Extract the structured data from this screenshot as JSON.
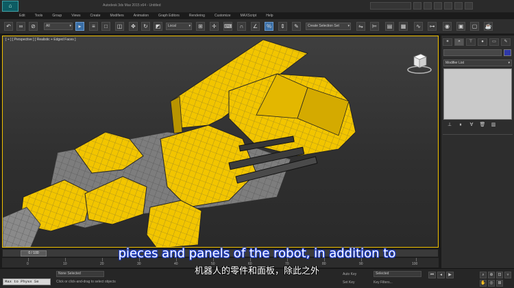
{
  "title_bar": {
    "title": "Autodesk 3ds Max 2015 x64 - Untitled",
    "accent_color": "#0d5c63"
  },
  "menu": {
    "items": [
      "Edit",
      "Tools",
      "Group",
      "Views",
      "Create",
      "Modifiers",
      "Animation",
      "Graph Editors",
      "Rendering",
      "Customize",
      "MAXScript",
      "Help"
    ]
  },
  "toolbar": {
    "selection_filter": "All",
    "reference_coord": "Local",
    "named_selection": "Create Selection Set"
  },
  "viewport": {
    "label": "[ + ] [ Perspective ] [ Realistic + Edged Faces ]",
    "active_border_color": "#f2c200",
    "model_color": "#f2c500"
  },
  "command_panel": {
    "modifier_list": "Modifier List",
    "object_color": "#2f39a8"
  },
  "timeline": {
    "slider": "0 / 100",
    "ticks": [
      "0",
      "10",
      "20",
      "30",
      "40",
      "50",
      "60",
      "70",
      "80",
      "90",
      "100"
    ]
  },
  "status": {
    "maxscript": "Max to Physx Se",
    "selection": "None Selected",
    "prompt": "Click or click-and-drag to select objects",
    "auto_key": "Auto Key",
    "selected": "Selected",
    "set_key": "Set Key",
    "key_filters": "Key Filters..."
  },
  "subtitles": {
    "english": "pieces and panels of the robot, in addition to",
    "chinese": "机器人的零件和面板，除此之外",
    "outline_color": "#1e3fd0"
  }
}
